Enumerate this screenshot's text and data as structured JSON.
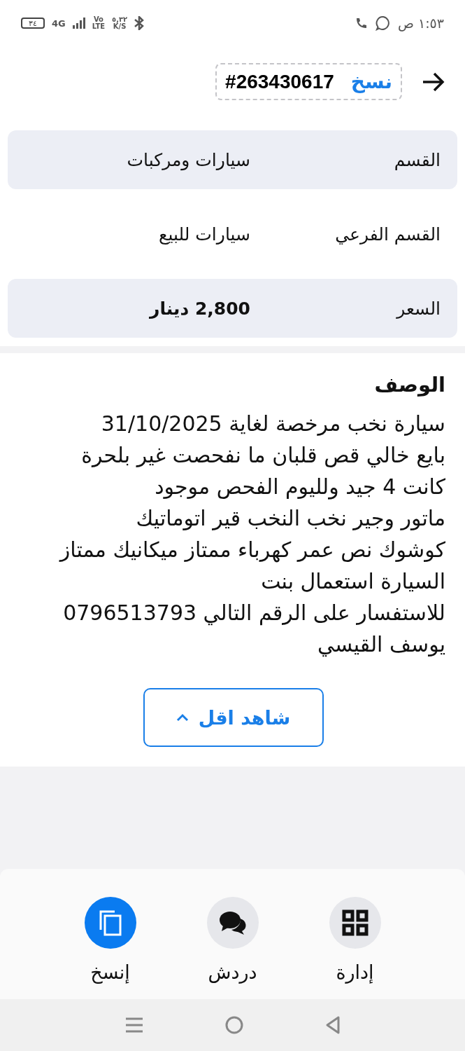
{
  "status_bar": {
    "time": "١:٥٣ ص",
    "battery": "٣٤",
    "network": "4G",
    "volte": [
      "Vo",
      "LTE"
    ],
    "speed": [
      "٥,٣٢",
      "K/S"
    ]
  },
  "header": {
    "copy_label": "نسخ",
    "ad_number": "#263430617"
  },
  "details": [
    {
      "label": "القسم",
      "value": "سيارات ومركبات",
      "bold": false
    },
    {
      "label": "القسم الفرعي",
      "value": "سيارات للبيع",
      "bold": false
    },
    {
      "label": "السعر",
      "value": "2,800 دينار",
      "bold": true
    }
  ],
  "description": {
    "title": "الوصف",
    "lines": [
      "سيارة نخب مرخصة لغاية 31/10/2025",
      "بايع خالي قص قلبان ما نفحصت غير بلحرة",
      "كانت 4 جيد ولليوم الفحص موجود",
      "ماتور وجير نخب النخب قير اتوماتيك",
      "كوشوك نص عمر  كهرباء ممتاز ميكانيك ممتاز",
      "السيارة استعمال بنت",
      "للاستفسار على الرقم التالي 0796513793",
      "يوسف القيسي"
    ],
    "toggle": "شاهد اقل",
    "expanded": true
  },
  "actions": [
    {
      "kind": "manage",
      "label": "إدارة",
      "highlighted": false
    },
    {
      "kind": "chat",
      "label": "دردش",
      "highlighted": false
    },
    {
      "kind": "copy",
      "label": "إنسخ",
      "highlighted": true
    }
  ]
}
